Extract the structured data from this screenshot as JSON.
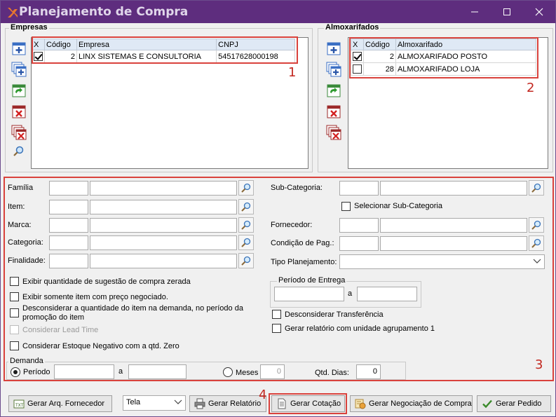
{
  "window": {
    "title": "Planejamento de Compra",
    "controls": [
      "minimize-icon",
      "maximize-icon",
      "close-icon"
    ]
  },
  "empresas": {
    "title": "Empresas",
    "columns": [
      "X",
      "Código",
      "Empresa",
      "CNPJ"
    ],
    "rows": [
      {
        "checked": true,
        "codigo": "2",
        "empresa": "LINX SISTEMAS E CONSULTORIA",
        "cnpj": "54517628000198"
      }
    ],
    "side_icons": [
      "add-icon",
      "add-multiple-icon",
      "refresh-icon",
      "remove-icon",
      "remove-all-icon",
      "search-icon"
    ]
  },
  "almoxarifados": {
    "title": "Almoxarifados",
    "columns": [
      "X",
      "Código",
      "Almoxarifado"
    ],
    "rows": [
      {
        "checked": true,
        "codigo": "2",
        "almoxarifado": "ALMOXARIFADO POSTO"
      },
      {
        "checked": false,
        "codigo": "28",
        "almoxarifado": "ALMOXARIFADO LOJA"
      }
    ],
    "side_icons": [
      "add-icon",
      "add-multiple-icon",
      "refresh-icon",
      "remove-icon",
      "remove-all-icon"
    ]
  },
  "annotations": {
    "n1": "1",
    "n2": "2",
    "n3": "3",
    "n4": "4",
    "color": "#d9423c"
  },
  "filters": {
    "familia": "Família",
    "item": "Item:",
    "marca": "Marca:",
    "categoria": "Categoria:",
    "finalidade": "Finalidade:",
    "sub_categoria": "Sub-Categoria:",
    "selecionar_sub_categoria": "Selecionar Sub-Categoria",
    "fornecedor": "Fornecedor:",
    "condicao_pag": "Condição de Pag.:",
    "tipo_planejamento": "Tipo Planejamento:",
    "tipo_planejamento_value": ""
  },
  "options": {
    "exibir_qtd_zerada": "Exibir quantidade de sugestão de compra zerada",
    "exibir_preco_negociado": "Exibir somente item com preço negociado.",
    "desconsiderar_demanda_line1": "Desconsiderar a quantidade do item na demanda, no período da",
    "desconsiderar_demanda_line2": "promoção do item",
    "considerar_lead_time": "Considerar Lead Time",
    "considerar_estoque_negativo": "Considerar Estoque Negativo com a qtd. Zero",
    "desconsiderar_transferencia": "Desconsiderar Transferência",
    "gerar_relatorio_agrupamento": "Gerar relatório com unidade agrupamento 1"
  },
  "periodo_entrega": {
    "legend": "Período de Entrega",
    "a_label": "a",
    "from": "",
    "to": ""
  },
  "demanda": {
    "legend": "Demanda",
    "periodo_label": "Período",
    "a_label": "a",
    "from": "",
    "to": "",
    "meses_label": "Meses",
    "meses_value": "0",
    "qtd_dias_label": "Qtd. Dias:",
    "qtd_dias_value": "0",
    "selected": "periodo"
  },
  "footer": {
    "gerar_arq_fornecedor": "Gerar Arq. Fornecedor",
    "output_select": "Tela",
    "gerar_relatorio": "Gerar Relatório",
    "gerar_cotacao": "Gerar Cotação",
    "gerar_negociacao": "Gerar Negociação de Compra",
    "gerar_pedido": "Gerar Pedido"
  }
}
